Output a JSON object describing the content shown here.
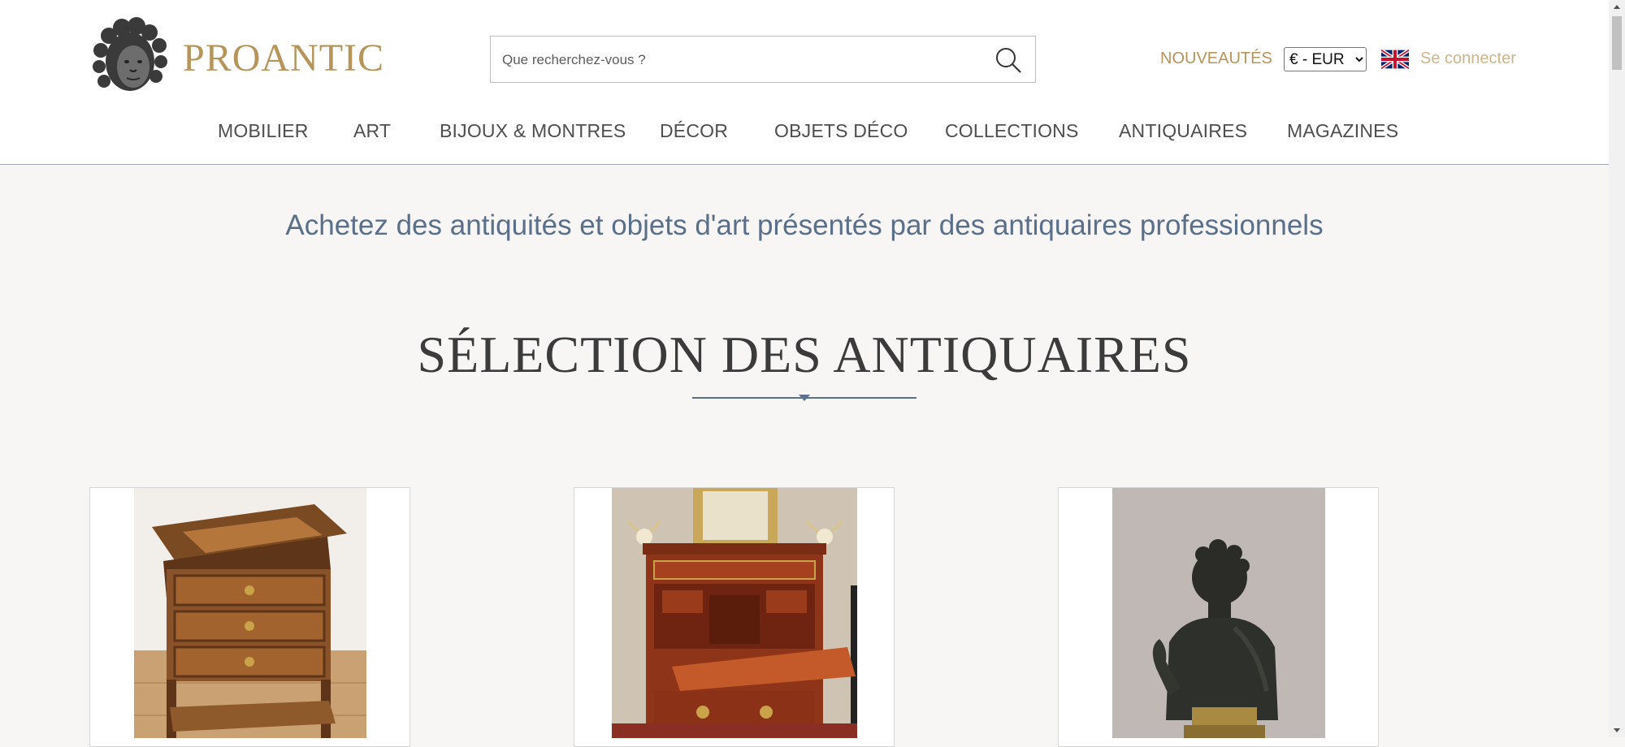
{
  "header": {
    "brand_name": "PROANTIC",
    "logo_icon": "cherub-head-icon",
    "search": {
      "placeholder": "Que recherchez-vous ?",
      "value": "",
      "icon": "search-icon"
    },
    "new_items_label": "NOUVEAUTÉS",
    "currency": {
      "selected": "€ - EUR",
      "options": [
        "€ - EUR"
      ]
    },
    "language_flag": "uk-flag-icon",
    "login_label": "Se connecter"
  },
  "nav": {
    "items": [
      {
        "label": "MOBILIER"
      },
      {
        "label": "ART"
      },
      {
        "label": "BIJOUX & MONTRES"
      },
      {
        "label": "DÉCOR"
      },
      {
        "label": "OBJETS DÉCO"
      },
      {
        "label": "COLLECTIONS"
      },
      {
        "label": "ANTIQUAIRES"
      },
      {
        "label": "MAGAZINES"
      }
    ]
  },
  "main": {
    "tagline": "Achetez des antiquités et objets d'art présentés par des antiquaires professionnels",
    "section_title": "SÉLECTION DES ANTIQUAIRES",
    "cards": [
      {
        "image": "marquetry-side-table-image"
      },
      {
        "image": "mahogany-secretary-desk-image"
      },
      {
        "image": "bronze-bust-image"
      }
    ]
  },
  "colors": {
    "brand_gold": "#b6955b",
    "login_gold": "#cdb58c",
    "accent_blue": "#5a6f8a",
    "page_background": "#f7f6f4"
  }
}
